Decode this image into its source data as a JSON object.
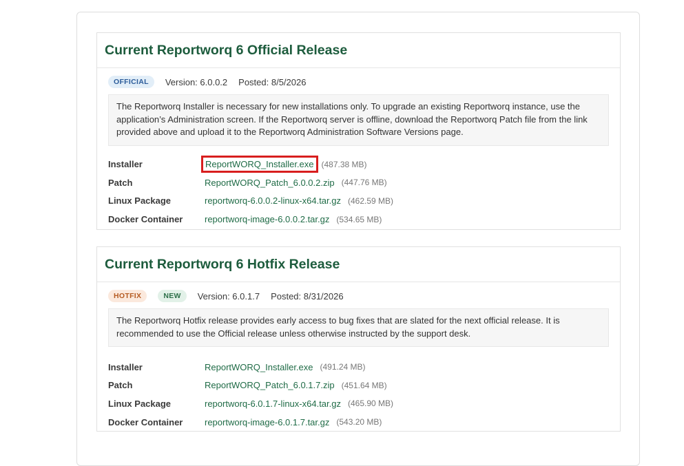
{
  "official": {
    "title": "Current Reportworq 6 Official Release",
    "badge": "OFFICIAL",
    "version": "Version: 6.0.0.2",
    "posted": "Posted: 8/5/2026",
    "notice": "The Reportworq Installer is necessary for new installations only. To upgrade an existing Reportworq instance, use the application’s Administration screen. If the Reportworq server is offline, download the Reportworq Patch file from the link provided above and upload it to the Reportworq Administration Software Versions page.",
    "files": [
      {
        "label": "Installer",
        "link": "ReportWORQ_Installer.exe",
        "size": "(487.38 MB)"
      },
      {
        "label": "Patch",
        "link": "ReportWORQ_Patch_6.0.0.2.zip",
        "size": "(447.76 MB)"
      },
      {
        "label": "Linux Package",
        "link": "reportworq-6.0.0.2-linux-x64.tar.gz",
        "size": "(462.59 MB)"
      },
      {
        "label": "Docker Container",
        "link": "reportworq-image-6.0.0.2.tar.gz",
        "size": "(534.65 MB)"
      }
    ]
  },
  "hotfix": {
    "title": "Current Reportworq 6 Hotfix Release",
    "badge": "HOTFIX",
    "badge_new": "NEW",
    "version": "Version: 6.0.1.7",
    "posted": "Posted: 8/31/2026",
    "notice": "The Reportworq Hotfix release provides early access to bug fixes that are slated for the next official release. It is recommended to use the Official release unless otherwise instructed by the support desk.",
    "files": [
      {
        "label": "Installer",
        "link": "ReportWORQ_Installer.exe",
        "size": "(491.24 MB)"
      },
      {
        "label": "Patch",
        "link": "ReportWORQ_Patch_6.0.1.7.zip",
        "size": "(451.64 MB)"
      },
      {
        "label": "Linux Package",
        "link": "reportworq-6.0.1.7-linux-x64.tar.gz",
        "size": "(465.90 MB)"
      },
      {
        "label": "Docker Container",
        "link": "reportworq-image-6.0.1.7.tar.gz",
        "size": "(543.20 MB)"
      }
    ]
  },
  "colors": {
    "title": "#1d5c3d",
    "link": "#1f6b46",
    "highlight": "#d81e1e"
  }
}
